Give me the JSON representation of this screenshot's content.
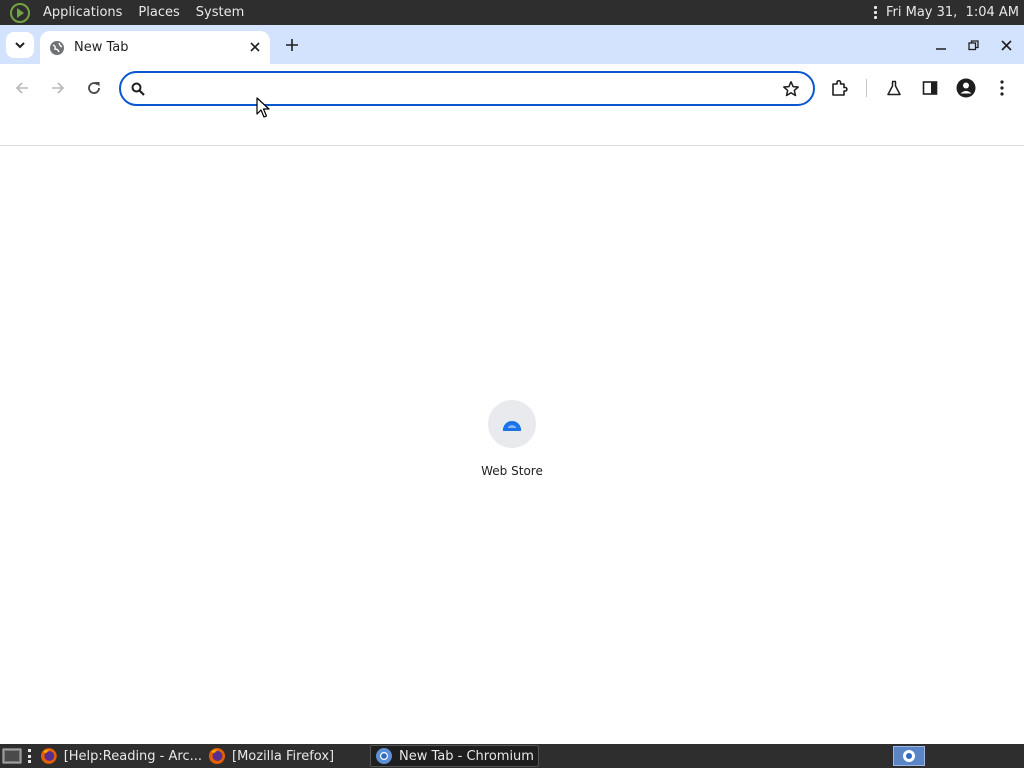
{
  "top_panel": {
    "menus": [
      "Applications",
      "Places",
      "System"
    ],
    "clock": "Fri May 31,  1:04 AM"
  },
  "browser": {
    "tab": {
      "title": "New Tab"
    },
    "omnibox": {
      "value": "",
      "placeholder": ""
    }
  },
  "new_tab_page": {
    "shortcuts": [
      {
        "label": "Web Store",
        "icon": "chrome-web-store-icon"
      }
    ]
  },
  "taskbar": {
    "tasks": [
      {
        "label": "[Help:Reading - Arc...",
        "icon": "firefox-icon",
        "active": false
      },
      {
        "label": "[Mozilla Firefox]",
        "icon": "firefox-icon",
        "active": false
      },
      {
        "label": "New Tab - Chromium",
        "icon": "chromium-icon",
        "active": true
      }
    ]
  },
  "colors": {
    "panel_bg": "#2e2e2e",
    "tabstrip_bg": "#d3e3fd",
    "omnibox_focus": "#0b57d0",
    "icon_gray": "#474747"
  }
}
